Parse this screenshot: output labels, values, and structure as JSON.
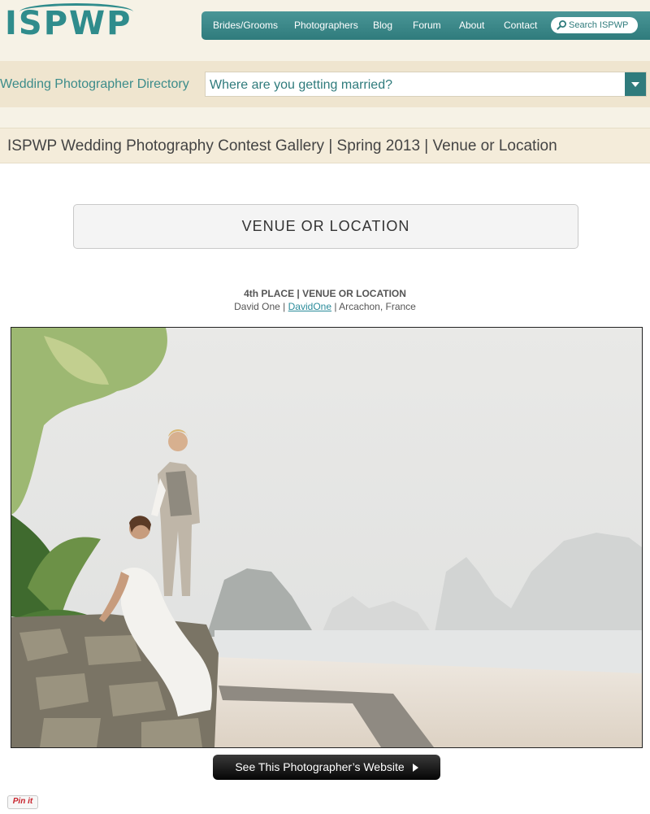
{
  "site": {
    "logo": "ISPWP"
  },
  "nav": {
    "items": [
      "Brides/Grooms",
      "Photographers",
      "Blog",
      "Forum",
      "About",
      "Contact"
    ],
    "search_placeholder": "Search ISPWP"
  },
  "directory": {
    "label": "Wedding Photographer Directory",
    "select_value": "Where are you getting married?"
  },
  "page": {
    "title": "ISPWP Wedding Photography Contest Gallery | Spring 2013 | Venue or Location",
    "category": "VENUE OR LOCATION",
    "place": "4th PLACE | VENUE OR LOCATION",
    "photographer_name": "David One",
    "photographer_handle": "DavidOne",
    "location": "Arcachon, France",
    "website_button": "See This Photographer’s Website",
    "pin_button": "Pin it"
  },
  "icons": {
    "search": "search-icon",
    "dropdown": "chevron-down-icon",
    "play": "play-arrow-icon"
  },
  "colors": {
    "brand_teal": "#2f7b7c",
    "background_cream": "#f6f2e6",
    "bar_tan": "#efe5cf"
  }
}
